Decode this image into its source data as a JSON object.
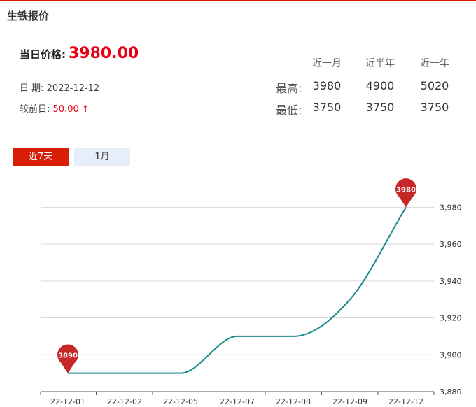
{
  "header": {
    "title": "生铁报价"
  },
  "price": {
    "label": "当日价格:",
    "value": "3980.00"
  },
  "date": {
    "label": "日 期:",
    "value": "2022-12-12"
  },
  "change": {
    "label": "较前日:",
    "value": "50.00",
    "arrow": "↑"
  },
  "stats": {
    "columns": [
      "近一月",
      "近半年",
      "近一年"
    ],
    "rows": [
      {
        "label": "最高:",
        "values": [
          "3980",
          "4900",
          "5020"
        ]
      },
      {
        "label": "最低:",
        "values": [
          "3750",
          "3750",
          "3750"
        ]
      }
    ]
  },
  "tabs": [
    {
      "label": "近7天",
      "active": true
    },
    {
      "label": "1月",
      "active": false
    }
  ],
  "colors": {
    "accent": "#d81e06",
    "price_red": "#e60012",
    "line": "#1a8a8a",
    "tab_inactive": "#e6eff9"
  },
  "chart_data": {
    "type": "line",
    "categories": [
      "22-12-01",
      "22-12-02",
      "22-12-05",
      "22-12-07",
      "22-12-08",
      "22-12-09",
      "22-12-12"
    ],
    "x_ticks": [
      "22-12-01",
      "22-12-02",
      "22-12-05",
      "22-12-07",
      "22-12-08",
      "22-12-09",
      "22-12-12"
    ],
    "values": [
      3890,
      3890,
      3890,
      3910,
      3910,
      3930,
      3980
    ],
    "ylim": [
      3880,
      3990
    ],
    "y_ticks": [
      "3,880",
      "3,900",
      "3,920",
      "3,940",
      "3,960",
      "3,980"
    ],
    "y_tick_values": [
      3880,
      3900,
      3920,
      3940,
      3960,
      3980
    ],
    "y_axis_position": "right",
    "grid": true,
    "markers": [
      {
        "category": "22-12-01",
        "value": 3890,
        "label": "3890"
      },
      {
        "category": "22-12-12",
        "value": 3980,
        "label": "3980"
      }
    ]
  }
}
